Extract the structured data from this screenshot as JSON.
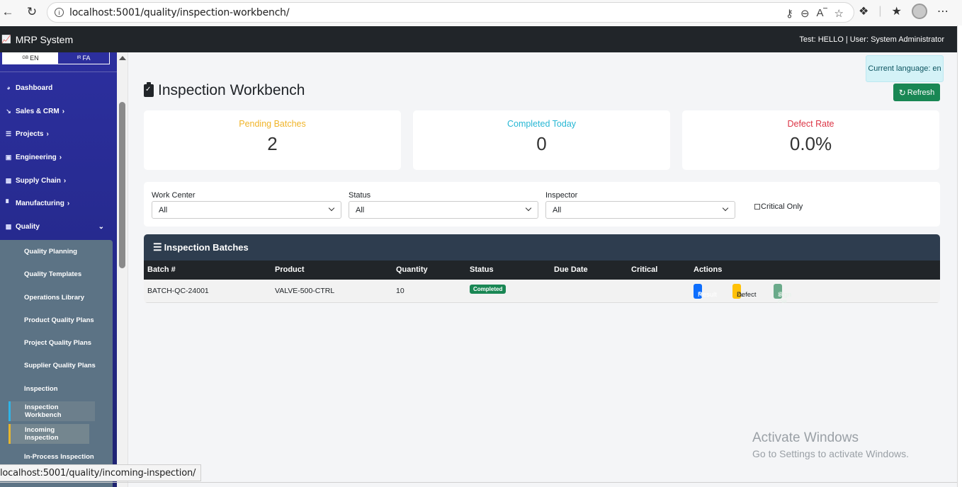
{
  "browser": {
    "url": "localhost:5001/quality/inspection-workbench/",
    "status_url": "localhost:5001/quality/incoming-inspection/"
  },
  "navbar": {
    "brand": "MRP System",
    "user_info": "Test: HELLO | User: System Administrator"
  },
  "language": {
    "en": "EN",
    "fa": "FA",
    "en_flag": "GB",
    "fa_flag": "IR",
    "current": "Current language: en"
  },
  "sidebar": {
    "items": [
      {
        "label": "Dashboard",
        "icon": "gauge-icon"
      },
      {
        "label": "Sales & CRM",
        "icon": "chart-line-icon"
      },
      {
        "label": "Projects",
        "icon": "list-icon"
      },
      {
        "label": "Engineering",
        "icon": "file-icon"
      },
      {
        "label": "Supply Chain",
        "icon": "truck-icon"
      },
      {
        "label": "Manufacturing",
        "icon": "factory-icon"
      },
      {
        "label": "Quality",
        "icon": "clipboard-check-icon"
      }
    ],
    "quality_sub": [
      "Quality Planning",
      "Quality Templates",
      "Operations Library",
      "Product Quality Plans",
      "Project Quality Plans",
      "Supplier Quality Plans",
      "Inspection",
      "Inspection Workbench",
      "Incoming Inspection",
      "In-Process Inspection"
    ]
  },
  "page": {
    "title": "Inspection Workbench",
    "refresh_label": "Refresh"
  },
  "stats": {
    "pending_label": "Pending Batches",
    "pending_value": "2",
    "completed_label": "Completed Today",
    "completed_value": "0",
    "defect_label": "Defect Rate",
    "defect_value": "0.0%"
  },
  "filters": {
    "work_center_label": "Work Center",
    "work_center_value": "All",
    "status_label": "Status",
    "status_value": "All",
    "inspector_label": "Inspector",
    "inspector_value": "All",
    "critical_label": "Critical Only"
  },
  "table": {
    "title": "Inspection Batches",
    "columns": [
      "Batch #",
      "Product",
      "Quantity",
      "Status",
      "Due Date",
      "Critical",
      "Actions"
    ],
    "rows": [
      {
        "batch": "BATCH-QC-24001",
        "product": "VALVE-500-CTRL",
        "quantity": "10",
        "status": "Completed",
        "due_date": "",
        "critical": "",
        "actions": [
          "Result",
          "Defect",
          "Sign Off"
        ]
      }
    ]
  },
  "watermark": {
    "line1": "Activate Windows",
    "line2": "Go to Settings to activate Windows."
  },
  "colors": {
    "pending": "#f0b429",
    "completed": "#27b7d4",
    "defect": "#dc3545",
    "refresh": "#198754",
    "result_btn": "#0d6efd",
    "defect_btn": "#ffc107",
    "signoff_btn": "#6aaa8a"
  }
}
